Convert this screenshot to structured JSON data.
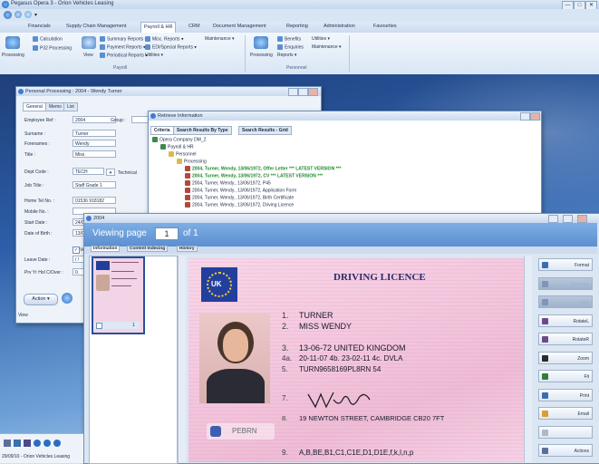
{
  "app": {
    "title": "Pegasus Opera 3 - Orion Vehicles Leasing",
    "window_controls": [
      "—",
      "□",
      "✕"
    ]
  },
  "menu": [
    "Financials",
    "Supply Chain Management",
    "Payroll & HR",
    "CRM",
    "Document Management",
    "Reporting",
    "Administration",
    "Favourites"
  ],
  "menu_active_index": 2,
  "ribbon": {
    "payroll": {
      "processing_label": "Processing",
      "calculation_label": "Calculation",
      "p32_label": "P32 Processing",
      "view_label": "View",
      "summary_reports": "Summary Reports ▾",
      "payment_reports": "Payment Reports ▾",
      "periodical_reports": "Periodical Reports ▾",
      "misc_reports": "Misc. Reports ▾",
      "edi_reports": "EDI/Special Reports ▾",
      "utilities": "Utilities ▾",
      "maintenance": "Maintenance ▾",
      "group_label": "Payroll"
    },
    "personnel": {
      "processing_label": "Processing",
      "benefits_label": "Benefits",
      "enquiries_label": "Enquiries",
      "reports_label": "Reports ▾",
      "utilities": "Utilities ▾",
      "maintenance": "Maintenance ▾",
      "group_label": "Personnel"
    }
  },
  "personal_window": {
    "title": "Personal Processing : 2004 - Wendy Turner",
    "tabs": [
      "General",
      "Memo",
      "List"
    ],
    "fields": [
      {
        "label": "Employee Ref :",
        "value": "2004"
      },
      {
        "label": "Surname :",
        "value": "Turner"
      },
      {
        "label": "Forenames :",
        "value": "Wendy"
      },
      {
        "label": "Title :",
        "value": "Miss"
      },
      {
        "label": "Dept Code :",
        "value": "TECH"
      },
      {
        "label": "Job Title :",
        "value": "Staff Grade 1"
      },
      {
        "label": "Home Tel No. :",
        "value": "01536 918182"
      },
      {
        "label": "Mobile No. :",
        "value": ""
      },
      {
        "label": "Start Date :",
        "value": "24/05"
      },
      {
        "label": "Date of Birth :",
        "value": "13/06"
      },
      {
        "label": "Leave Date :",
        "value": "/ /"
      },
      {
        "label": "Prv Yr Hol C/Over :",
        "value": "0."
      }
    ],
    "group_label": "Group :",
    "dept_name": "Technical",
    "checkbox_label": "Ve",
    "action_button": "Action ▾",
    "status": "View"
  },
  "retrieve_window": {
    "title": "Retrieve Information",
    "tabs": [
      "Criteria",
      "Search Results By Type",
      "Search Results - Grid"
    ],
    "tree": [
      {
        "indent": 0,
        "text": "Opera Company DM_2",
        "highlight": false
      },
      {
        "indent": 1,
        "text": "Payroll & HR",
        "highlight": false
      },
      {
        "indent": 2,
        "text": "Personnel",
        "highlight": false
      },
      {
        "indent": 3,
        "text": "Processing",
        "highlight": false
      },
      {
        "indent": 4,
        "text": "2004, Turner, Wendy, 13/06/1972, Offer Letter *** LATEST VERSION ***",
        "highlight": true
      },
      {
        "indent": 4,
        "text": "2004, Turner, Wendy, 13/06/1972, CV *** LATEST VERSION ***",
        "highlight": true
      },
      {
        "indent": 4,
        "text": "2004, Turner, Wendy., 13/06/1972, P45",
        "highlight": false
      },
      {
        "indent": 4,
        "text": "2004, Turner, Wendy., 13/06/1972, Application Form",
        "highlight": false
      },
      {
        "indent": 4,
        "text": "2004, Turner, Wendy., 13/06/1972, Birth Certificate",
        "highlight": false
      },
      {
        "indent": 4,
        "text": "2004, Turner, Wendy., 13/06/1972, Driving Licence",
        "highlight": false
      }
    ]
  },
  "viewer_window": {
    "title": "2004",
    "viewing_label": "Viewing page",
    "page_number": "1",
    "of_label": "of 1",
    "tabs": [
      "Information",
      "Content Indexing",
      "History"
    ],
    "thumb_number": "1",
    "right_buttons": [
      {
        "label": "Format",
        "dim": false,
        "color": "#3a6fb0"
      },
      {
        "label": "Previous",
        "dim": true,
        "color": "#7f96b8"
      },
      {
        "label": "Next",
        "dim": true,
        "color": "#7f96b8"
      },
      {
        "label": "RotateL",
        "dim": false,
        "color": "#6b4a8a"
      },
      {
        "label": "RotateR",
        "dim": false,
        "color": "#6b4a8a"
      },
      {
        "label": "Zoom",
        "dim": false,
        "color": "#2b2b2b"
      },
      {
        "label": "Fit",
        "dim": false,
        "color": "#2f7f3a"
      },
      {
        "label": "Print",
        "dim": false,
        "color": "#3a6fb0"
      },
      {
        "label": "Email",
        "dim": false,
        "color": "#d7a030"
      },
      {
        "label": "",
        "dim": false,
        "color": "#b0b8c4"
      },
      {
        "label": "Actions",
        "dim": false,
        "color": "#5a6f9a"
      }
    ]
  },
  "licence": {
    "heading": "DRIVING LICENCE",
    "country": "UK",
    "lines": [
      {
        "num": "1.",
        "text": "TURNER"
      },
      {
        "num": "2.",
        "text": "MISS WENDY"
      },
      {
        "num": "3.",
        "text": "13-06-72 UNITED KINGDOM"
      },
      {
        "num": "4a.",
        "text": "20-11-07    4b. 23-02-11    4c. DVLA"
      },
      {
        "num": "5.",
        "text": "TURN9658169PL8RN    54"
      },
      {
        "num": "7.",
        "text": ""
      },
      {
        "num": "8.",
        "text": "19 NEWTON STREET, CAMBRIDGE CB20 7FT"
      },
      {
        "num": "9.",
        "text": "A,B,BE,B1,C1,C1E,D1,D1E,f,k,l,n,p"
      }
    ],
    "signature": "W Turner",
    "reg_text": "PEBRN"
  },
  "taskbar": {
    "status": "29/09/10 - Orion Vehicles Leasing"
  }
}
